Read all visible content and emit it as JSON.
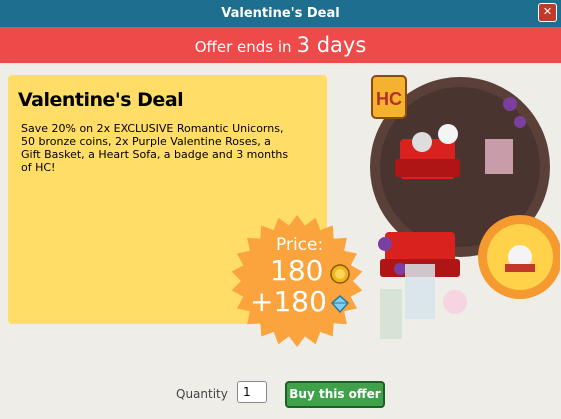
{
  "window": {
    "title": "Valentine's Deal",
    "close_glyph": "✕"
  },
  "banner": {
    "prefix": "Offer ends in",
    "value": "3 days"
  },
  "offer": {
    "title": "Valentine's Deal",
    "description": "Save 20% on 2x EXCLUSIVE Romantic Unicorns, 50 bronze coins, 2x Purple Valentine Roses, a Gift Basket, a Heart Sofa, a badge and 3 months of HC!"
  },
  "price": {
    "label": "Price:",
    "coins": "180",
    "diamonds": "+180",
    "coin_icon": "credit-coin-icon",
    "diamond_icon": "diamond-icon"
  },
  "purchase": {
    "quantity_label": "Quantity",
    "quantity_value": "1",
    "buy_label": "Buy this offer"
  },
  "illustration": {
    "badge_text": "HC"
  },
  "colors": {
    "titlebar": "#1d6e8f",
    "banner": "#ef4a4a",
    "card": "#ffdd66",
    "price_badge": "#fba33c",
    "buy_button": "#3fa24a"
  }
}
